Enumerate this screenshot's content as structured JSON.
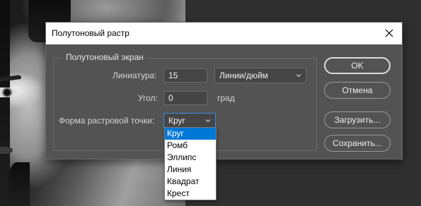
{
  "dialog": {
    "title": "Полутоновый растр"
  },
  "screen_group": {
    "legend": "Полутоновый экран",
    "frequency_label": "Линиатура:",
    "frequency_value": "15",
    "frequency_unit_selected": "Линии/дюйм",
    "angle_label": "Угол:",
    "angle_value": "0",
    "angle_unit": "град",
    "shape_label": "Форма растровой точки:",
    "shape_selected": "Круг"
  },
  "shape_options": [
    "Круг",
    "Ромб",
    "Эллипс",
    "Линия",
    "Квадрат",
    "Крест"
  ],
  "buttons": {
    "ok": "OK",
    "cancel": "Отмена",
    "load": "Загрузить...",
    "save": "Сохранить..."
  },
  "icons": {
    "close": "close-icon",
    "chevron": "chevron-down-icon"
  },
  "colors": {
    "dialog_bg": "#535353",
    "accent": "#0078d7",
    "focus_border": "#3a8ee6"
  }
}
